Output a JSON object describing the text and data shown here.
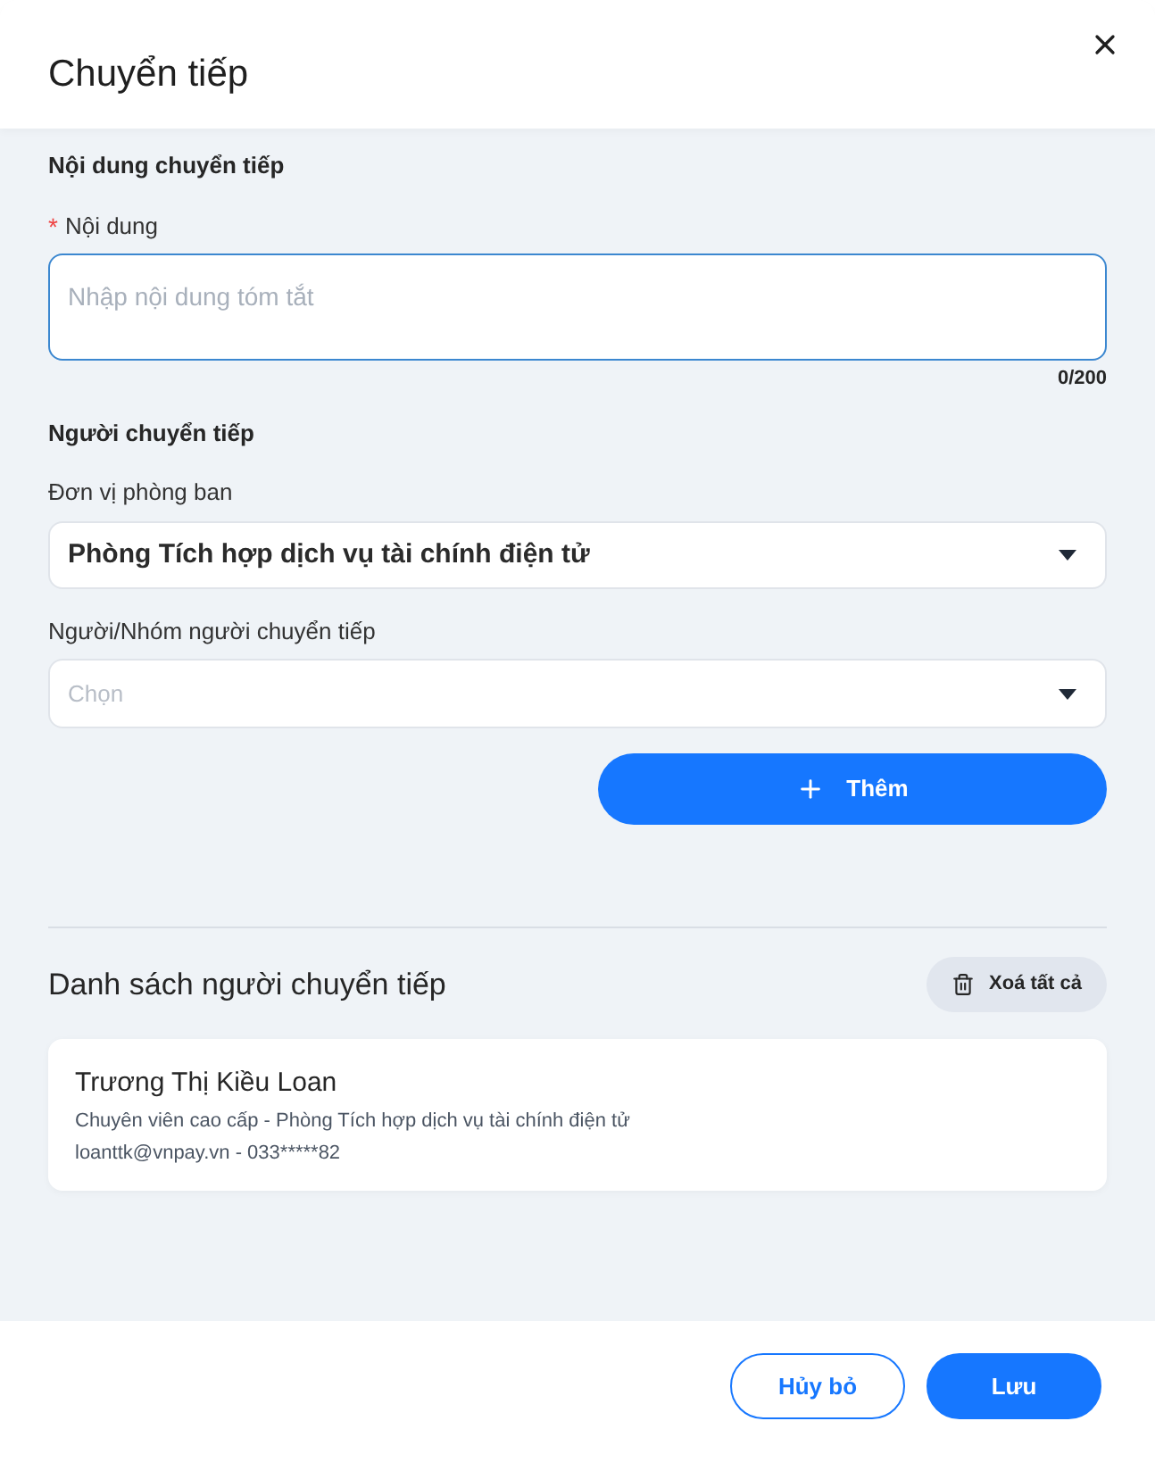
{
  "dialog": {
    "title": "Chuyển tiếp"
  },
  "content_section": {
    "heading": "Nội dung chuyển tiếp",
    "field": {
      "required_mark": "*",
      "label": "Nội dung",
      "placeholder": "Nhập nội dung tóm tắt",
      "focused": true,
      "counter": "0/200"
    }
  },
  "forwarder_section": {
    "heading": "Người chuyển tiếp",
    "fields": [
      {
        "label": "Đơn vị phòng ban",
        "value": "Phòng Tích hợp dịch vụ tài chính điện tử"
      },
      {
        "label": "Người/Nhóm người chuyển tiếp",
        "placeholder": "Chọn"
      }
    ],
    "add_button": "Thêm"
  },
  "list": {
    "title": "Danh sách người chuyển tiếp",
    "clear_button": "Xoá tất cả",
    "items": [
      {
        "name": "Trương Thị Kiều Loan",
        "position": "Chuyên viên cao cấp - Phòng Tích hợp dịch vụ tài chính điện tử",
        "contact": "loanttk@vnpay.vn - 033*****82"
      }
    ]
  },
  "footer": {
    "buttons": [
      {
        "label": "Hủy bỏ",
        "kind": "secondary"
      },
      {
        "label": "Lưu",
        "kind": "primary"
      }
    ]
  }
}
